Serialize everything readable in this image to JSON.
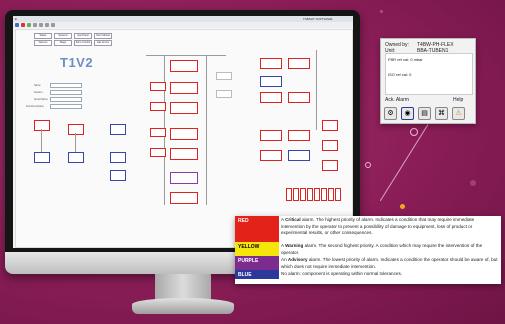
{
  "app": {
    "title_bar_text": "TSBSHT SOFTWARE",
    "diagram_title": "T1V2",
    "header_buttons": [
      "Status",
      "Systems",
      "Gas Panel",
      "Gas Cabinet",
      "Vacuum",
      "Diags",
      "Zone Control",
      "Gas Ammo"
    ],
    "form_labels": [
      "Name",
      "Section",
      "Serial Name",
      "Sub-Description"
    ]
  },
  "callout": {
    "owned_by_label": "Owned by:",
    "owned_by_value": "T4BW-PH-FLEX",
    "unit_label": "Unit:",
    "unit_value": "BBA-TUBEN1",
    "line1": "FBR ref val: 0 mbar",
    "line2": "ISO ref val: 0",
    "ack_label": "Ack. Alarm",
    "help_label": "Help",
    "icons": [
      "settings-icon",
      "alarm-icon",
      "chart-icon",
      "network-icon",
      "warning-icon"
    ]
  },
  "legend": {
    "rows": [
      {
        "tag": "RED",
        "color": "#e32219",
        "tag_text_color": "#ffffff",
        "prefix": "A ",
        "bold": "Critical",
        "text": " alarm. The highest priority of alarm. Indicates a condition that may require immediate intervention by the operator to prevent a possibility of damage to equipment, loss of product or experimental results, or other consequences."
      },
      {
        "tag": "YELLOW",
        "color": "#f5e50a",
        "tag_text_color": "#000000",
        "prefix": "A ",
        "bold": "Warning",
        "text": " alarm. The second highest priority. A condition which may require the intervention of the operator."
      },
      {
        "tag": "PURPLE",
        "color": "#7b2c8e",
        "tag_text_color": "#ffffff",
        "prefix": "An ",
        "bold": "Advisory",
        "text": " alarm. The lowest priority of alarm. Indicates a condition the operator should be aware of, but which does not require immediate intervention."
      },
      {
        "tag": "BLUE",
        "color": "#2b3a9a",
        "tag_text_color": "#ffffff",
        "prefix": "",
        "bold": "",
        "text": "No alarm: component is operating within normal tolerances."
      }
    ]
  },
  "colors": {
    "background": "#8c1f5a",
    "accent_connector": "#f4a623",
    "alarm_red": "#d22222",
    "normal_blue": "#3348a8"
  }
}
